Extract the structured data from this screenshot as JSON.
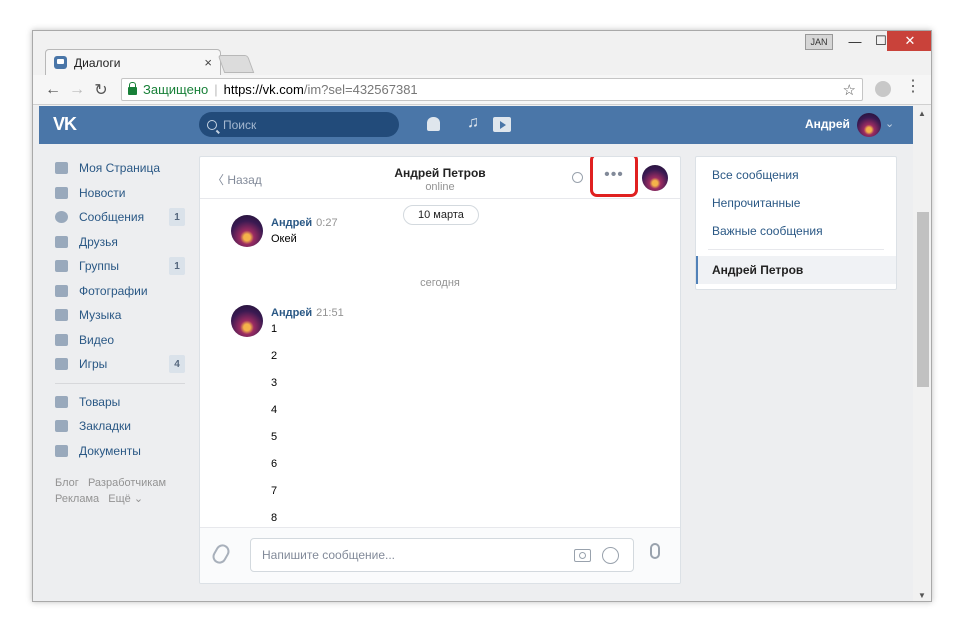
{
  "browser": {
    "tab_title": "Диалоги",
    "tab_close": "×",
    "user_badge": "JAN",
    "win_min": "—",
    "win_max": "☐",
    "win_close": "✕",
    "back": "←",
    "forward": "→",
    "reload": "↻",
    "secure_label": "Защищено",
    "separator": "|",
    "url_scheme_host": "https://vk.com",
    "url_path": "/im?sel=432567381",
    "bookmark": "☆",
    "menu": "⋮"
  },
  "vk_header": {
    "logo": "VK",
    "search_placeholder": "Поиск",
    "user_name": "Андрей",
    "chevron": "⌄"
  },
  "sidebar": {
    "items": [
      {
        "label": "Моя Страница",
        "icon": "home-icon"
      },
      {
        "label": "Новости",
        "icon": "news-icon"
      },
      {
        "label": "Сообщения",
        "icon": "messages-icon",
        "badge": "1"
      },
      {
        "label": "Друзья",
        "icon": "friends-icon"
      },
      {
        "label": "Группы",
        "icon": "groups-icon",
        "badge": "1"
      },
      {
        "label": "Фотографии",
        "icon": "photos-icon"
      },
      {
        "label": "Музыка",
        "icon": "music-icon"
      },
      {
        "label": "Видео",
        "icon": "video-icon"
      },
      {
        "label": "Игры",
        "icon": "games-icon",
        "badge": "4"
      }
    ],
    "items2": [
      {
        "label": "Товары",
        "icon": "goods-icon"
      },
      {
        "label": "Закладки",
        "icon": "bookmarks-icon"
      },
      {
        "label": "Документы",
        "icon": "documents-icon"
      }
    ],
    "footer": {
      "blog": "Блог",
      "dev": "Разработчикам",
      "ads": "Реклама",
      "more": "Ещё ⌄"
    }
  },
  "chat": {
    "back_label": "Назад",
    "contact_name": "Андрей Петров",
    "contact_status": "online",
    "more_label": "•••",
    "date_pill": "10 марта",
    "today_label": "сегодня",
    "message1": {
      "author": "Андрей",
      "time": "0:27",
      "text": "Окей"
    },
    "message2": {
      "author": "Андрей",
      "time": "21:51",
      "lines": [
        "1",
        "2",
        "3",
        "4",
        "5",
        "6",
        "7",
        "8"
      ]
    },
    "compose_placeholder": "Напишите сообщение..."
  },
  "right_menu": {
    "all": "Все сообщения",
    "unread": "Непрочитанные",
    "important": "Важные сообщения",
    "active": "Андрей Петров"
  },
  "colors": {
    "vk_blue": "#4a76a8",
    "link": "#2a5885",
    "highlight_box": "#e02020",
    "secure_green": "#188038"
  }
}
